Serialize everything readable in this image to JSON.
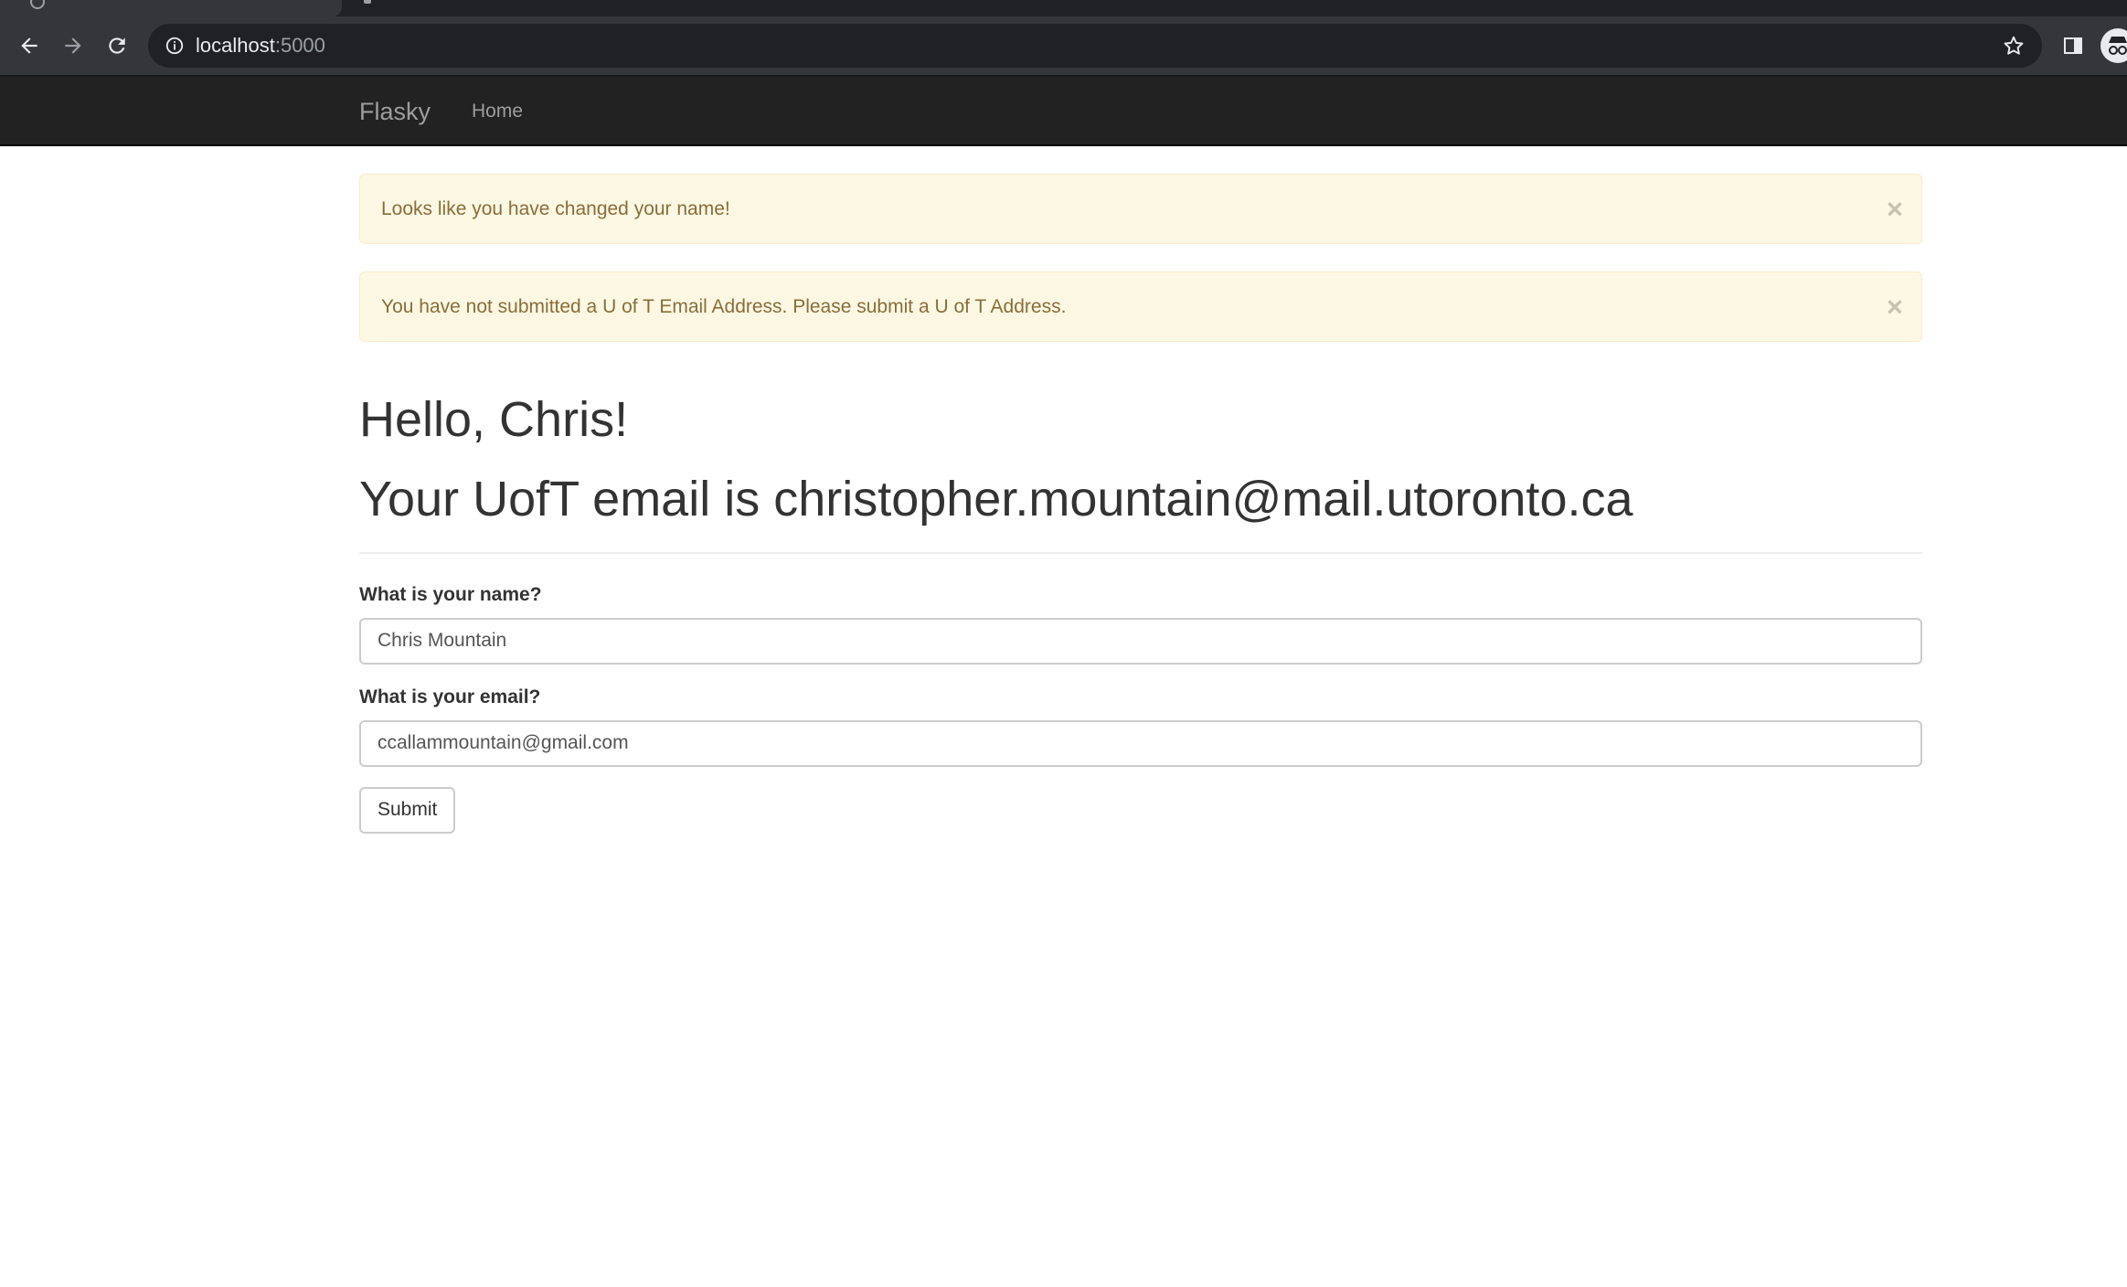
{
  "browser": {
    "url_host": "localhost",
    "url_port": ":5000",
    "icons": [
      "back-icon",
      "forward-icon",
      "reload-icon",
      "site-info-icon",
      "bookmark-star-icon",
      "side-panel-icon",
      "incognito-avatar-icon"
    ]
  },
  "navbar": {
    "brand": "Flasky",
    "links": [
      {
        "label": "Home"
      }
    ]
  },
  "alerts": [
    {
      "message": "Looks like you have changed your name!",
      "close": "×"
    },
    {
      "message": "You have not submitted a U of T Email Address. Please submit a U of T Address.",
      "close": "×"
    }
  ],
  "page": {
    "greeting": "Hello, Chris!",
    "email_line": "Your UofT email is christopher.mountain@mail.utoronto.ca"
  },
  "form": {
    "name_label": "What is your name?",
    "name_value": "Chris Mountain",
    "email_label": "What is your email?",
    "email_value": "ccallammountain@gmail.com",
    "submit_label": "Submit"
  },
  "colors": {
    "navbar_bg": "#222222",
    "alert_bg": "#fcf8e3",
    "alert_text": "#8a6d3b",
    "chrome_bg": "#35363a"
  }
}
